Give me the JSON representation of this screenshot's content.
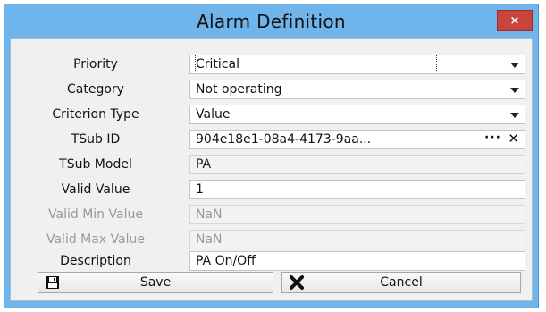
{
  "window": {
    "title": "Alarm Definition",
    "close_label": "×",
    "accent_color": "#6fb4ea",
    "close_color": "#c9443d"
  },
  "form": {
    "priority": {
      "label": "Priority",
      "value": "Critical"
    },
    "category": {
      "label": "Category",
      "value": "Not operating"
    },
    "criterion_type": {
      "label": "Criterion Type",
      "value": "Value"
    },
    "tsub_id": {
      "label": "TSub ID",
      "value": "904e18e1-08a4-4173-9aa...",
      "browse_label": "···",
      "clear_label": "✕"
    },
    "tsub_model": {
      "label": "TSub Model",
      "value": "PA"
    },
    "valid_value": {
      "label": "Valid Value",
      "value": "1"
    },
    "valid_min_value": {
      "label": "Valid Min Value",
      "value": "NaN"
    },
    "valid_max_value": {
      "label": "Valid Max Value",
      "value": "NaN"
    },
    "description": {
      "label": "Description",
      "value": "PA On/Off"
    }
  },
  "buttons": {
    "save": {
      "label": "Save",
      "icon": "save-icon"
    },
    "cancel": {
      "label": "Cancel",
      "icon": "close-icon"
    }
  }
}
